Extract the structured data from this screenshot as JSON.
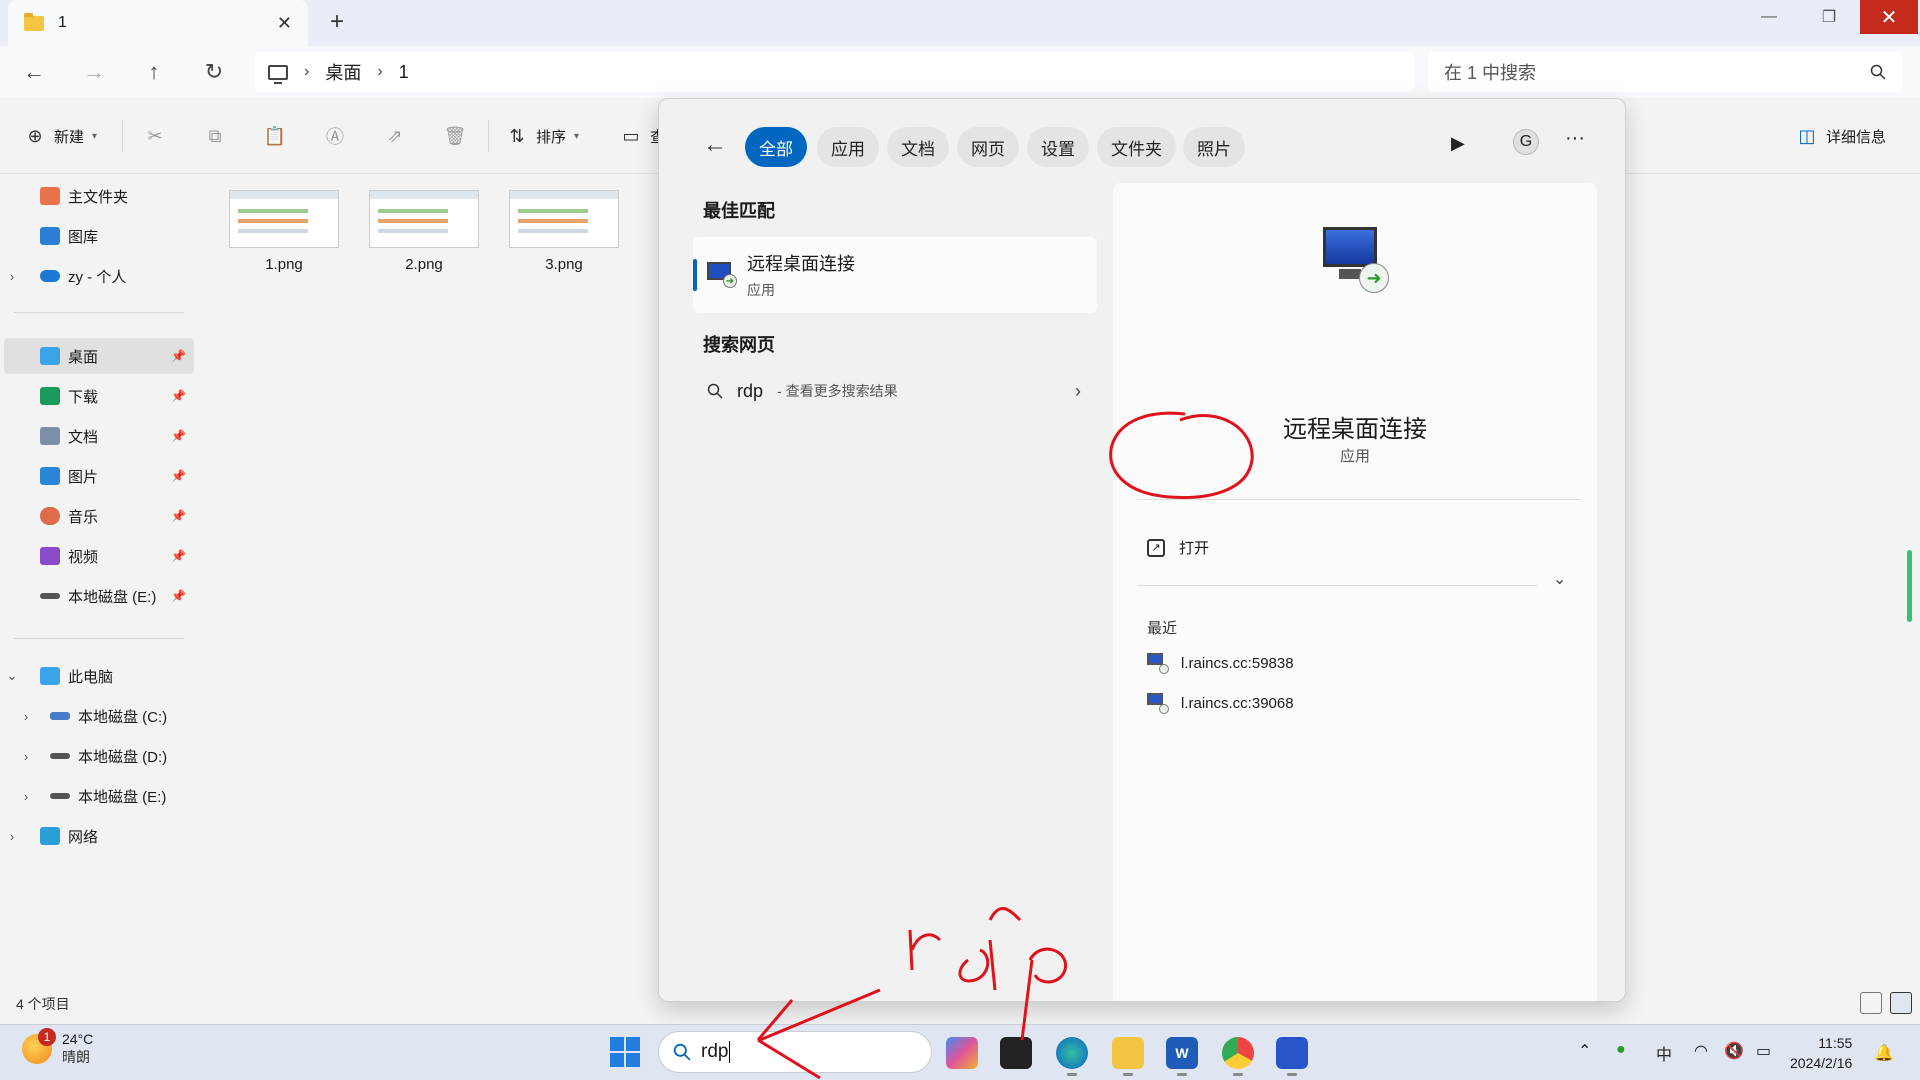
{
  "window": {
    "tab_title": "1",
    "tab_close": "✕",
    "tab_add": "+",
    "minimize": "—",
    "restore": "❐",
    "close": "✕"
  },
  "nav": {
    "back": "←",
    "forward": "→",
    "up": "↑",
    "refresh": "↻",
    "breadcrumb": [
      "桌面",
      "1"
    ],
    "breadcrumb_sep": "›",
    "search_placeholder": "在 1 中搜索"
  },
  "toolbar": {
    "new_label": "新建",
    "sort_label": "排序",
    "view_label": "查",
    "details_label": "详细信息"
  },
  "sidebar": {
    "quick": [
      {
        "label": "主文件夹",
        "icon": "home-icon",
        "color": "#e8734a"
      },
      {
        "label": "图库",
        "icon": "gallery-icon",
        "color": "#2b7fd4"
      },
      {
        "label": "zy - 个人",
        "icon": "onedrive-icon",
        "color": "#1b78d4"
      }
    ],
    "pinned": [
      {
        "label": "桌面",
        "icon": "desktop-icon",
        "color": "#3ba3e8"
      },
      {
        "label": "下载",
        "icon": "download-icon",
        "color": "#1a9b5b"
      },
      {
        "label": "文档",
        "icon": "documents-icon",
        "color": "#7c8fa8"
      },
      {
        "label": "图片",
        "icon": "pictures-icon",
        "color": "#2b86d8"
      },
      {
        "label": "音乐",
        "icon": "music-icon",
        "color": "#e06b4a"
      },
      {
        "label": "视频",
        "icon": "video-icon",
        "color": "#8a4cc8"
      },
      {
        "label": "本地磁盘 (E:)",
        "icon": "drive-icon",
        "color": "#555555"
      }
    ],
    "this_pc": "此电脑",
    "drives": [
      "本地磁盘 (C:)",
      "本地磁盘 (D:)",
      "本地磁盘 (E:)"
    ],
    "network": "网络"
  },
  "files": [
    {
      "name": "1.png"
    },
    {
      "name": "2.png"
    },
    {
      "name": "3.png"
    }
  ],
  "status": {
    "item_count": "4 个项目"
  },
  "search_panel": {
    "filters": [
      "全部",
      "应用",
      "文档",
      "网页",
      "设置",
      "文件夹",
      "照片"
    ],
    "active_filter": "全部",
    "g_label": "G",
    "more": "···",
    "best_match_title": "最佳匹配",
    "best_match_name": "远程桌面连接",
    "best_match_type": "应用",
    "web_title": "搜索网页",
    "web_query": "rdp",
    "web_more": "- 查看更多搜索结果",
    "detail_name": "远程桌面连接",
    "detail_type": "应用",
    "open_label": "打开",
    "recent_title": "最近",
    "recent_items": [
      "l.raincs.cc:59838",
      "l.raincs.cc:39068"
    ]
  },
  "taskbar": {
    "weather_temp": "24°C",
    "weather_desc": "晴朗",
    "weather_badge": "1",
    "search_text": "rdp",
    "ime": "中",
    "time": "11:55",
    "date": "2024/2/16"
  },
  "annotations": {
    "handwriting": "rdp",
    "color": "#e0121b"
  }
}
